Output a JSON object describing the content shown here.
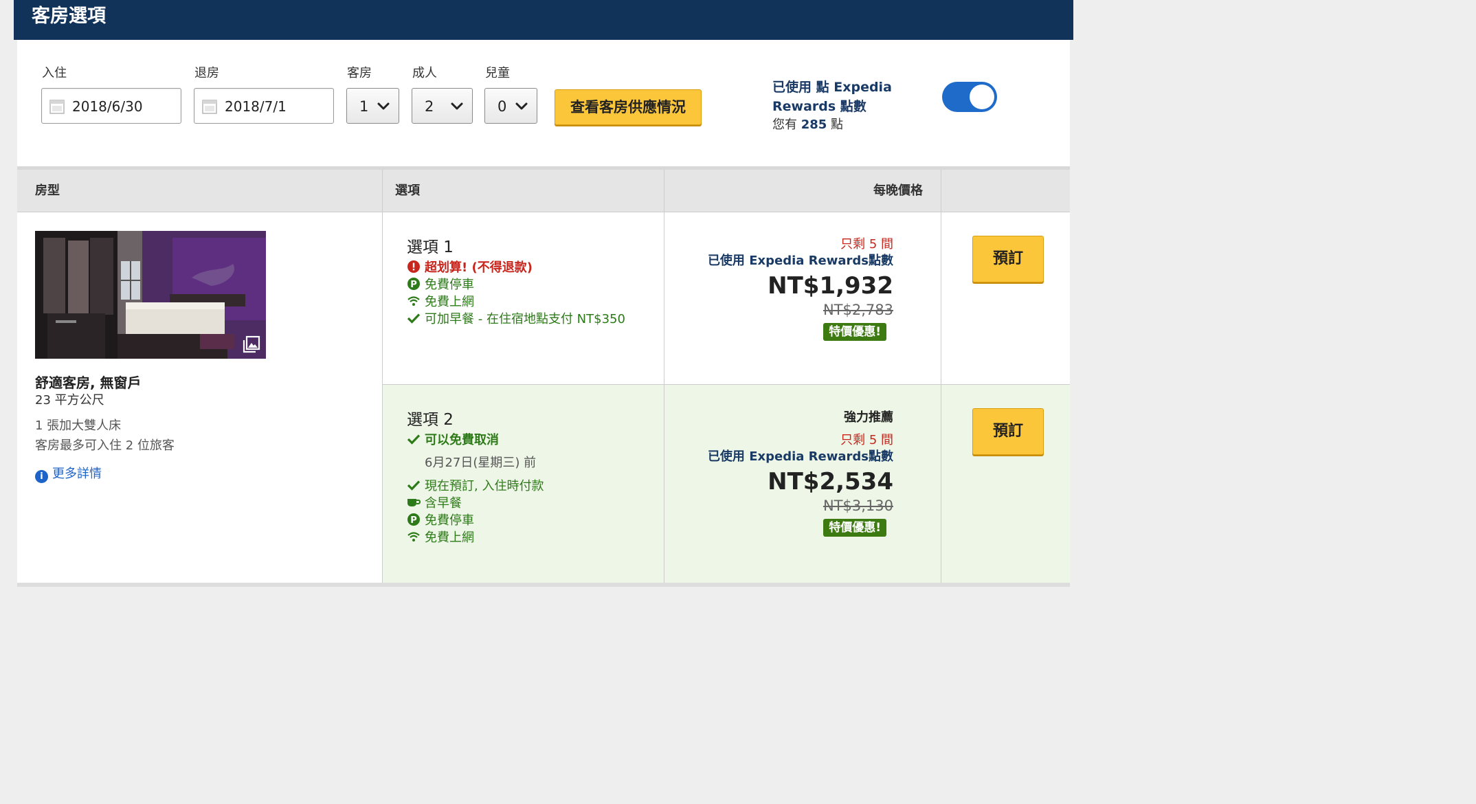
{
  "header": {
    "title": "客房選項"
  },
  "search": {
    "checkin_label": "入住",
    "checkin_value": "2018/6/30",
    "checkout_label": "退房",
    "checkout_value": "2018/7/1",
    "rooms_label": "客房",
    "rooms_value": "1",
    "adults_label": "成人",
    "adults_value": "2",
    "children_label": "兒童",
    "children_value": "0",
    "check_button": "查看客房供應情況"
  },
  "rewards": {
    "line1": "已使用 點 Expedia",
    "line2": "Rewards 點數",
    "points_prefix": "您有",
    "points_value": "285",
    "points_suffix": "點",
    "toggle_on": true
  },
  "table": {
    "col_room_type": "房型",
    "col_options": "選項",
    "col_price": "每晚價格"
  },
  "room": {
    "name": "舒適客房, 無窗戶",
    "size": "23 平方公尺",
    "bed": "1 張加大雙人床",
    "occupancy": "客房最多可入住 2 位旅客",
    "more_details": "更多詳情"
  },
  "options": [
    {
      "title": "選項 1",
      "features": [
        {
          "icon": "alert-icon",
          "text": "超划算! (不得退款)"
        },
        {
          "icon": "parking-icon",
          "text": "免費停車"
        },
        {
          "icon": "wifi-icon",
          "text": "免費上網"
        },
        {
          "icon": "check-icon",
          "text": "可加早餐 - 在住宿地點支付 NT$350"
        }
      ],
      "rooms_left": "只剩 5 間",
      "rewards_used": "已使用 Expedia Rewards點數",
      "price": "NT$1,932",
      "original_price": "NT$2,783",
      "deal_badge": "特價優惠!",
      "book_label": "預訂"
    },
    {
      "title": "選項 2",
      "recommend": "強力推薦",
      "free_cancel": "可以免費取消",
      "cancel_before": "6月27日(星期三) 前",
      "features": [
        {
          "icon": "check-icon",
          "text": "現在預訂, 入住時付款"
        },
        {
          "icon": "coffee-icon",
          "text": "含早餐"
        },
        {
          "icon": "parking-icon",
          "text": "免費停車"
        },
        {
          "icon": "wifi-icon",
          "text": "免費上網"
        }
      ],
      "rooms_left": "只剩 5 間",
      "rewards_used": "已使用 Expedia Rewards點數",
      "price": "NT$2,534",
      "original_price": "NT$3,130",
      "deal_badge": "特價優惠!",
      "book_label": "預訂"
    }
  ],
  "colors": {
    "header_bg": "#123359",
    "button_yellow": "#fcc63b",
    "deal_green": "#3d7a11",
    "alert_red": "#c8261c",
    "link_blue": "#1e64c8",
    "recommended_row_bg": "#eef7e7"
  }
}
